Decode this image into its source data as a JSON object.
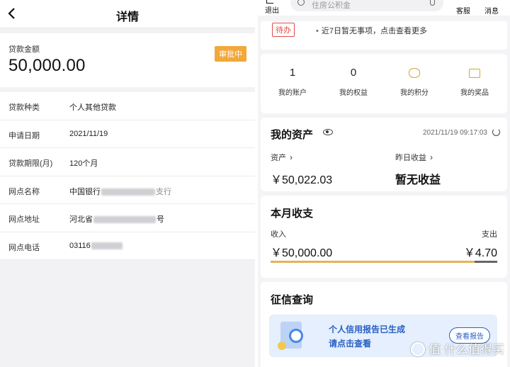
{
  "left": {
    "title": "详情",
    "amount_label": "贷款金额",
    "amount_value": "50,000.00",
    "status_badge": "审批中",
    "rows": [
      {
        "label": "贷款种类",
        "value": "个人其他贷款"
      },
      {
        "label": "申请日期",
        "value": "2021/11/19"
      },
      {
        "label": "贷款期限(月)",
        "value": "120个月"
      },
      {
        "label": "网点名称",
        "value": "中国银行",
        "value_tail": "支行"
      },
      {
        "label": "网点地址",
        "value": "河北省",
        "value_tail": "号"
      },
      {
        "label": "网点电话",
        "value": "03116"
      }
    ]
  },
  "right": {
    "topbar": {
      "exit_label": "退出",
      "search_placeholder": "住房公积金",
      "service_label": "客服",
      "messages_label": "消息"
    },
    "todo": {
      "badge": "待办",
      "text": "近7日暂无事项，点击查看更多"
    },
    "stats": [
      {
        "value": "1",
        "label": "我的账户"
      },
      {
        "value": "0",
        "label": "我的权益"
      },
      {
        "icon": "coin-stack-icon",
        "label": "我的积分"
      },
      {
        "icon": "prize-card-icon",
        "label": "我的奖品"
      }
    ],
    "assets": {
      "title": "我的资产",
      "timestamp": "2021/11/19 09:17:03",
      "assets_label": "资产",
      "assets_value": "￥50,022.03",
      "yesterday_label": "昨日收益",
      "yesterday_value": "暂无收益"
    },
    "monthly": {
      "title": "本月收支",
      "income_label": "收入",
      "income_value": "￥50,000.00",
      "expense_label": "支出",
      "expense_value": "￥4.70",
      "income_share": 0.9
    },
    "credit": {
      "title": "征信查询",
      "banner_line1": "个人信用报告已生成",
      "banner_line2": "请点击查看",
      "button_label": "查看报告"
    }
  },
  "watermark": "值 什么值得买",
  "colors": {
    "status_badge": "#f3a83a",
    "todo_red": "#e24b4b",
    "gold": "#d4a437",
    "income_bar": "#e6b256",
    "expense_bar": "#666666",
    "link_blue": "#2a5fc4",
    "banner_bg": "#e5effd"
  }
}
